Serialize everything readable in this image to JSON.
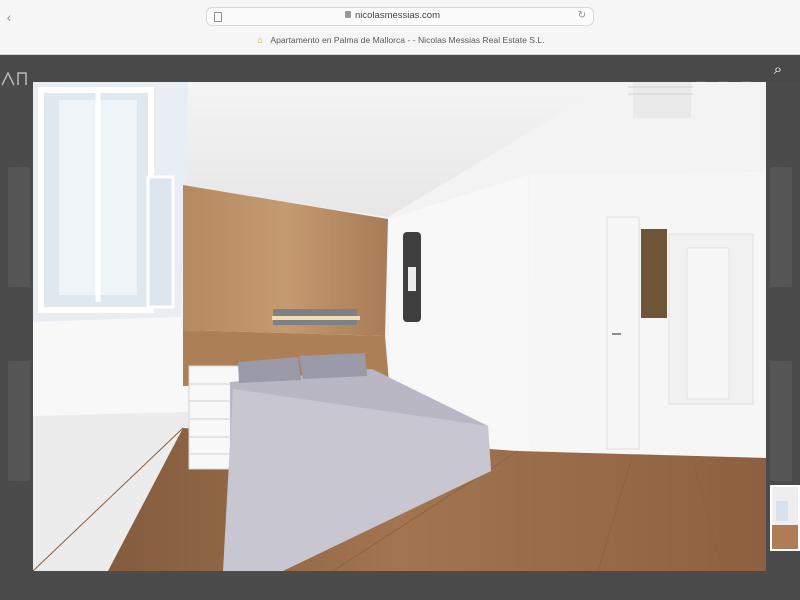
{
  "browser": {
    "url": "nicolasmessias.com",
    "tab_title": "Apartamento en Palma de Mallorca - - Nicolas Messias Real Estate S.L."
  },
  "icons": {
    "back": "chevron-left-icon",
    "reader": "reader-icon",
    "lock": "lock-icon",
    "reload": "reload-icon",
    "search": "search-icon",
    "tab": "home-icon"
  },
  "colors": {
    "overlay": "#3a3a3a",
    "wood": "#b58a61",
    "floor": "#9a6e47"
  }
}
